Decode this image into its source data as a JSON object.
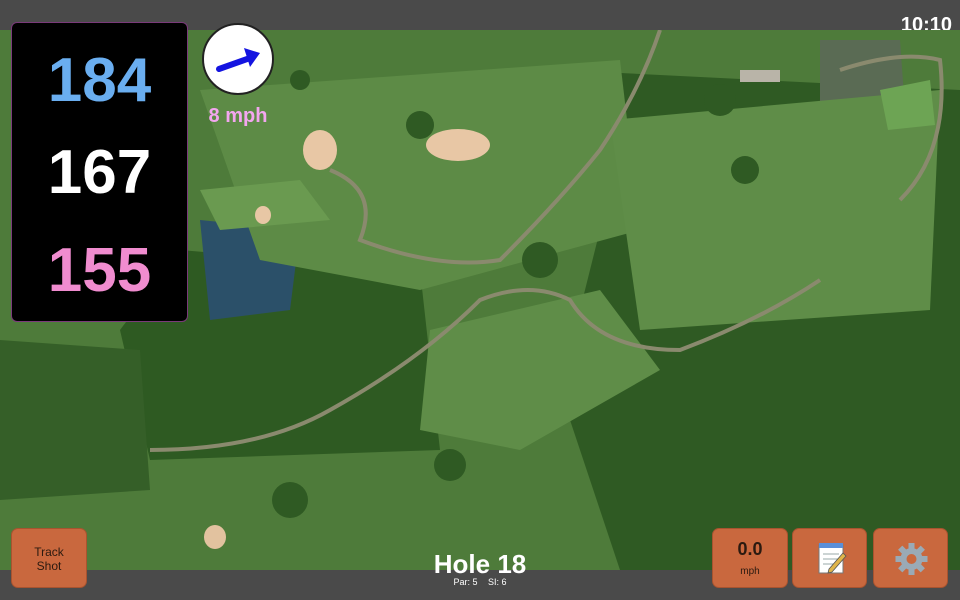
{
  "status_bar": {
    "time": "10:10"
  },
  "yardages": {
    "back": "184",
    "middle": "167",
    "front": "155",
    "colors": {
      "back": "#6aaef0",
      "middle": "#ffffff",
      "front": "#f08ccf"
    }
  },
  "wind": {
    "direction_icon": "arrow-icon",
    "speed": "8 mph",
    "speed_color": "#f3a6ef"
  },
  "hole": {
    "title": "Hole 18",
    "par": "Par: 5",
    "si": "SI: 6"
  },
  "buttons": {
    "track_shot": {
      "line1": "Track",
      "line2": "Shot"
    },
    "speed": {
      "value": "0.0",
      "unit": "mph"
    },
    "notes_icon": "notepad-icon",
    "settings_icon": "gear-icon"
  },
  "colors": {
    "button": "#c9683e",
    "bar": "#4a4a4a",
    "panel": "#000000"
  }
}
